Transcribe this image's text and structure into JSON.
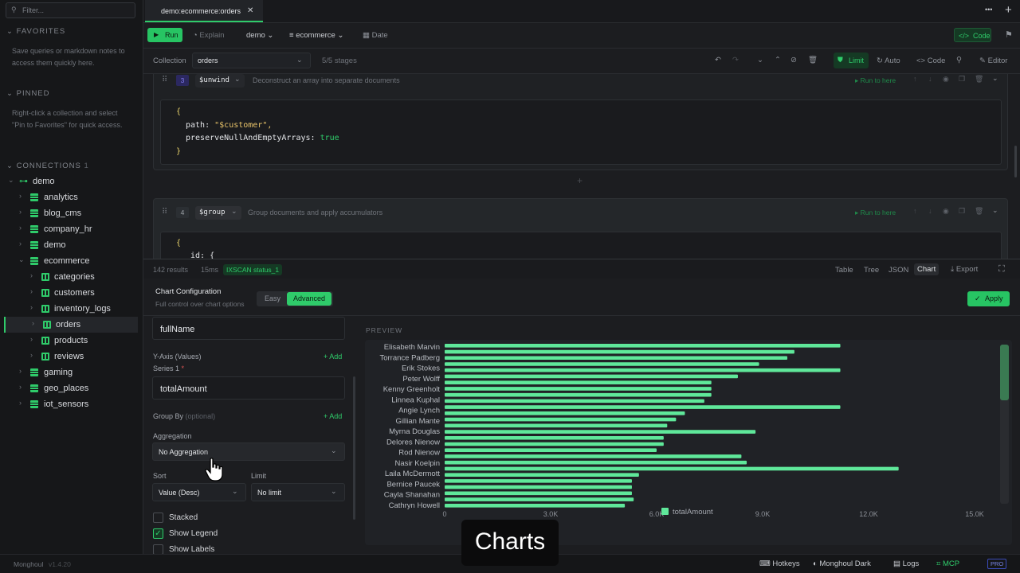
{
  "sidebar": {
    "filter_placeholder": "Filter...",
    "favorites": {
      "title": "FAVORITES",
      "note": "Save queries or markdown notes to access them quickly here."
    },
    "pinned": {
      "title": "PINNED",
      "note": "Right-click a collection and select \"Pin to Favorites\" for quick access."
    },
    "connections": {
      "title": "CONNECTIONS",
      "count": "1"
    },
    "connection_name": "demo",
    "databases": [
      {
        "label": "analytics"
      },
      {
        "label": "blog_cms"
      },
      {
        "label": "company_hr"
      },
      {
        "label": "demo"
      },
      {
        "label": "ecommerce"
      },
      {
        "label": "gaming"
      },
      {
        "label": "geo_places"
      },
      {
        "label": "iot_sensors"
      }
    ],
    "collections": [
      {
        "label": "categories"
      },
      {
        "label": "customers"
      },
      {
        "label": "inventory_logs"
      },
      {
        "label": "orders"
      },
      {
        "label": "products"
      },
      {
        "label": "reviews"
      }
    ]
  },
  "tabbar": {
    "active_tab": "demo:ecommerce:orders",
    "close": "✕",
    "more": "•••",
    "add": "+"
  },
  "toolbar": {
    "run": "Run",
    "explain": "Explain",
    "connection": "demo",
    "database": "ecommerce",
    "date": "Date",
    "code": "Code"
  },
  "collection_bar": {
    "label": "Collection",
    "value": "orders",
    "stages": "5/5 stages",
    "limit": "Limit",
    "auto": "Auto",
    "code": "Code",
    "editor": "Editor"
  },
  "stages": [
    {
      "num": "3",
      "op": "$unwind",
      "desc": "Deconstruct an array into separate documents",
      "run_here": "Run to here",
      "code": {
        "open": "{",
        "line1_key": "path:",
        "line1_val": "\"$customer\",",
        "line2_key": "preserveNullAndEmptyArrays:",
        "line2_val": "true",
        "close": "}"
      }
    },
    {
      "num": "4",
      "op": "$group",
      "desc": "Group documents and apply accumulators",
      "run_here": "Run to here",
      "code": {
        "open": "{",
        "line1_key": "_id: {"
      }
    }
  ],
  "results": {
    "count": "142 results",
    "time": "15ms",
    "index": "IXSCAN status_1",
    "views": [
      "Table",
      "Tree",
      "JSON",
      "Chart"
    ],
    "active_view": "Chart",
    "export": "Export"
  },
  "chart_config": {
    "title": "Chart Configuration",
    "subtitle": "Full control over chart options",
    "modes": [
      "Easy",
      "Advanced"
    ],
    "active_mode": "Advanced",
    "apply": "Apply",
    "x_field": "fullName",
    "y_axis_label": "Y-Axis (Values)",
    "add": "+ Add",
    "series_label": "Series 1",
    "required": "*",
    "series_value": "totalAmount",
    "group_by_label": "Group By",
    "group_by_optional": "(optional)",
    "aggregation_label": "Aggregation",
    "aggregation_value": "No Aggregation",
    "sort_label": "Sort",
    "sort_value": "Value (Desc)",
    "limit_label": "Limit",
    "limit_value": "No limit",
    "stacked": "Stacked",
    "show_legend": "Show Legend",
    "show_labels": "Show Labels",
    "preview": "PREVIEW"
  },
  "chart_data": {
    "type": "bar",
    "orientation": "horizontal",
    "legend": "bottom",
    "categories": [
      "Elisabeth Marvin",
      "Torrance Padberg",
      "Erik Stokes",
      "Peter Wolff",
      "Kenny Greenholt",
      "Linnea Kuphal",
      "Angie Lynch",
      "Gillian Mante",
      "Myrna Douglas",
      "Delores Nienow",
      "Rod Nienow",
      "Nasir Koelpin",
      "Laila McDermott",
      "Bernice Paucek",
      "Cayla Shanahan",
      "Cathryn Howell"
    ],
    "series": [
      {
        "name": "totalAmount",
        "color": "#5fe89a"
      }
    ],
    "bars": [
      [
        0,
        11200
      ],
      [
        0,
        9900
      ],
      [
        0,
        9700
      ],
      [
        0,
        8900
      ],
      [
        0,
        11200
      ],
      [
        0,
        8300
      ],
      [
        0,
        7550
      ],
      [
        0,
        7550
      ],
      [
        0,
        7550
      ],
      [
        0,
        7350
      ],
      [
        0,
        11200
      ],
      [
        0,
        6800
      ],
      [
        0,
        6550
      ],
      [
        0,
        6300
      ],
      [
        0,
        8800
      ],
      [
        0,
        6200
      ],
      [
        0,
        6200
      ],
      [
        0,
        6000
      ],
      [
        0,
        8400
      ],
      [
        0,
        8550
      ],
      [
        0,
        12850
      ],
      [
        0,
        5500
      ],
      [
        0,
        5300
      ],
      [
        0,
        5300
      ],
      [
        0,
        5300
      ],
      [
        0,
        5350
      ],
      [
        0,
        5100
      ]
    ],
    "x_ticks": [
      "0",
      "3.0K",
      "6.0K",
      "9.0K",
      "12.0K",
      "15.0K"
    ],
    "xlim": [
      0,
      15000
    ]
  },
  "statusbar": {
    "app": "Monghoul",
    "version": "v1.4.20",
    "hotkeys": "Hotkeys",
    "theme": "Monghoul Dark",
    "logs": "Logs",
    "mcp": "MCP",
    "pro": "PRO"
  },
  "overlay": "Charts"
}
